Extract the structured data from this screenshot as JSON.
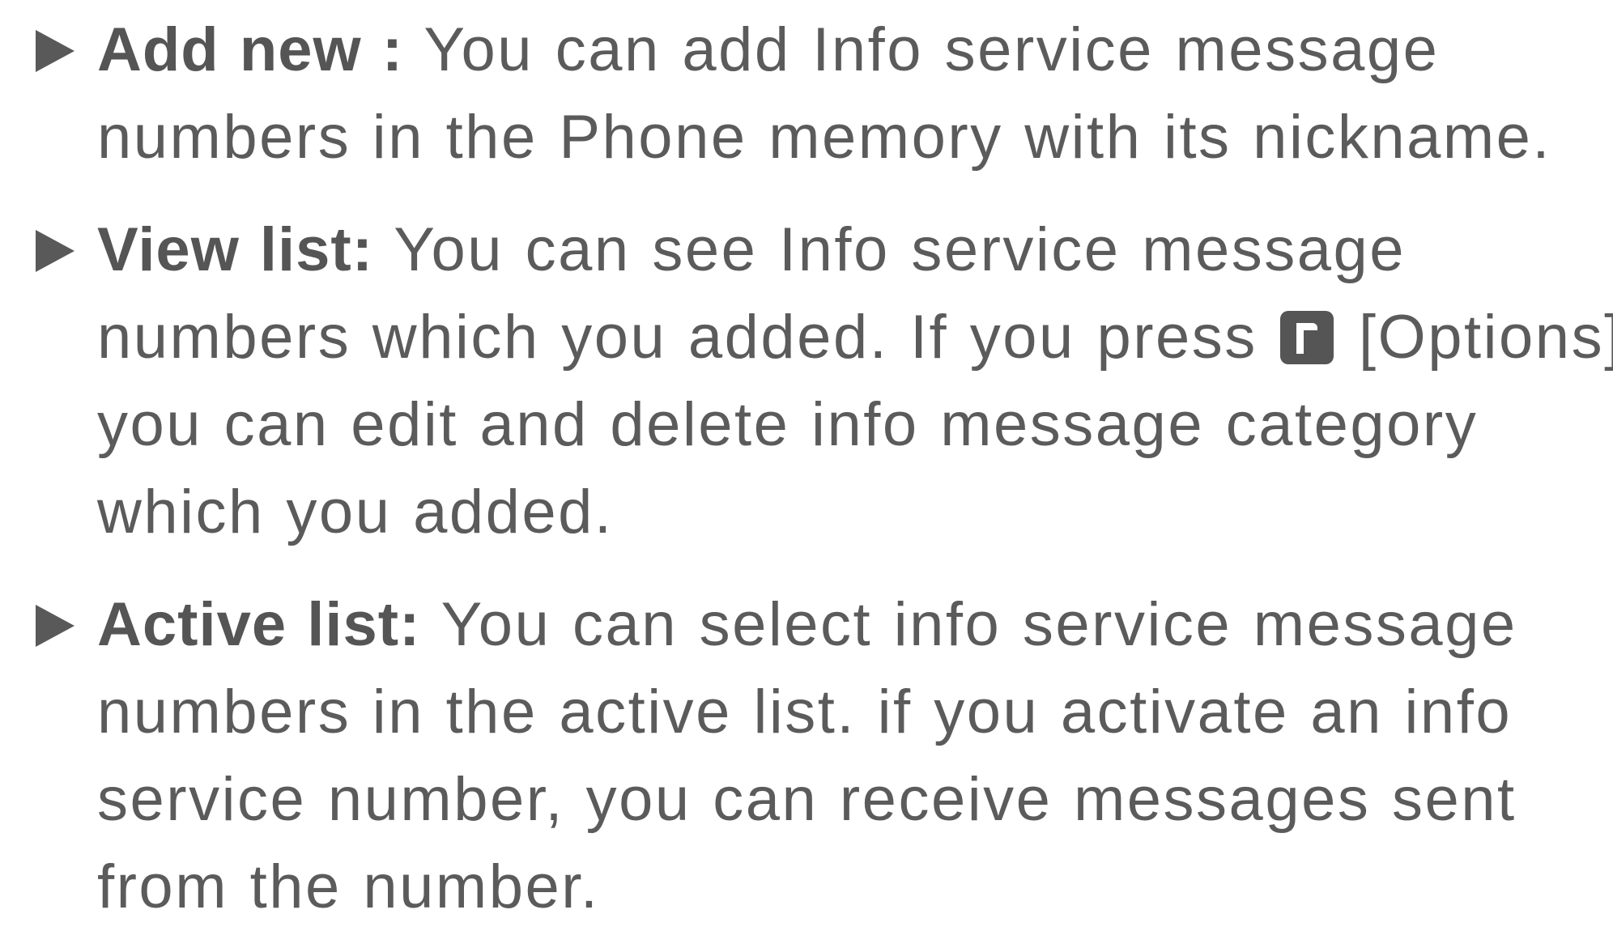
{
  "items": [
    {
      "term": "Add new :",
      "lines": [
        "You can add Info service message",
        "numbers in the Phone memory with its nickname."
      ]
    },
    {
      "term": "View list:",
      "line1": "You can see Info service message",
      "line2_before_icon": "numbers which you added. If you press",
      "icon": "soft-key-icon",
      "line2_after_icon": "[Options],",
      "line3": "you can edit and delete info message category",
      "line4": "which you added."
    },
    {
      "term": "Active list:",
      "lines": [
        "You can select info service message",
        "numbers in the active list. if you activate an info",
        "service number, you can receive messages sent",
        "from the number."
      ]
    }
  ],
  "colors": {
    "text": "#5b5b5b",
    "bullet": "#595959",
    "icon_background": "#555555"
  },
  "bullet_icon": "triangle-bullet-icon"
}
